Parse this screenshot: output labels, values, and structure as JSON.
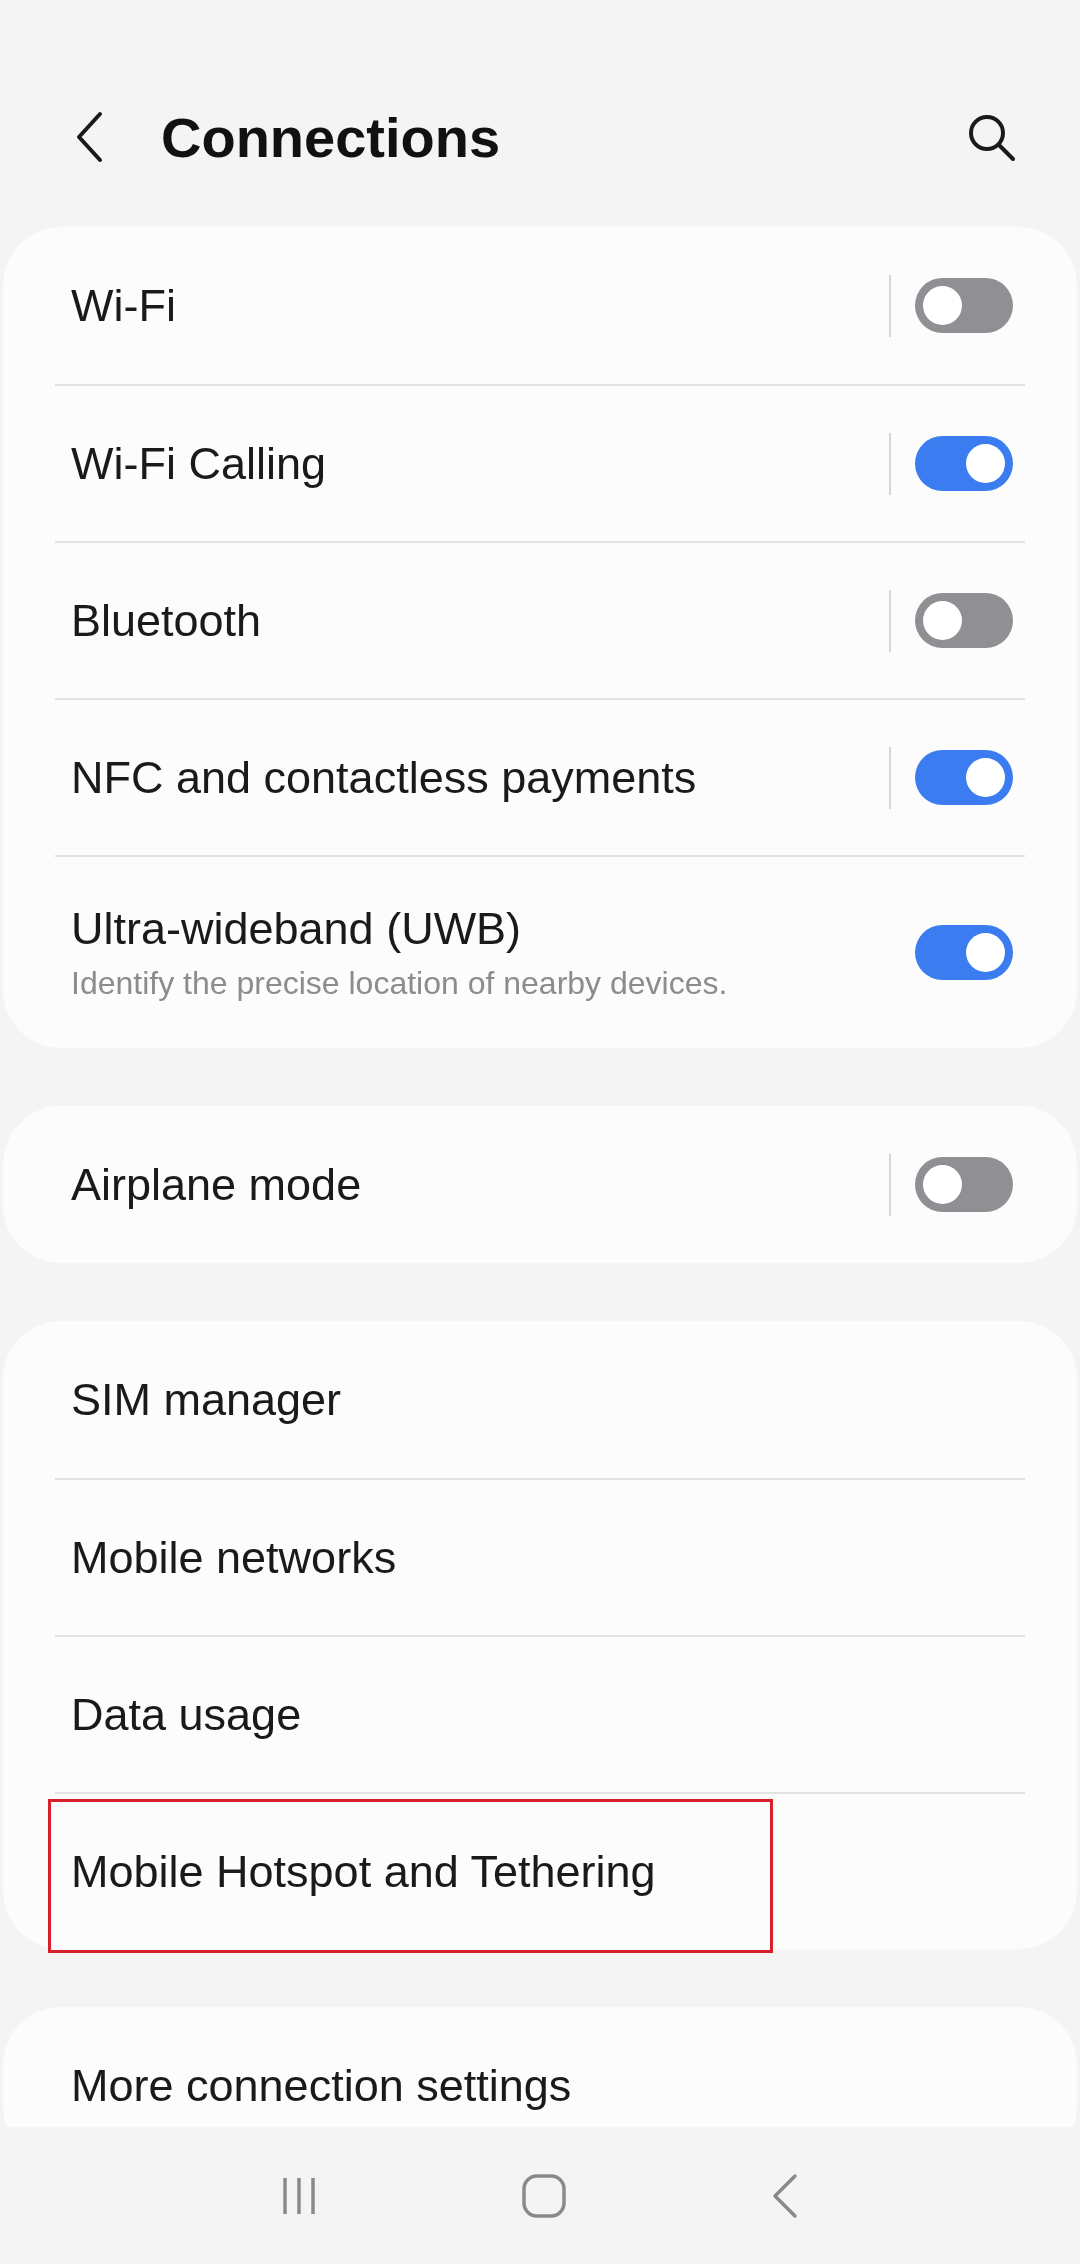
{
  "header": {
    "title": "Connections"
  },
  "groups": [
    {
      "items": [
        {
          "kind": "toggle",
          "label": "Wi-Fi",
          "on": false,
          "split": true,
          "highlighted": false
        },
        {
          "kind": "toggle",
          "label": "Wi-Fi Calling",
          "on": true,
          "split": true,
          "highlighted": false
        },
        {
          "kind": "toggle",
          "label": "Bluetooth",
          "on": false,
          "split": true,
          "highlighted": false
        },
        {
          "kind": "toggle",
          "label": "NFC and contactless payments",
          "on": true,
          "split": true,
          "highlighted": false
        },
        {
          "kind": "toggle",
          "label": "Ultra-wideband (UWB)",
          "subtitle": "Identify the precise location of nearby devices.",
          "on": true,
          "split": false,
          "highlighted": false
        }
      ]
    },
    {
      "items": [
        {
          "kind": "toggle",
          "label": "Airplane mode",
          "on": false,
          "split": true,
          "highlighted": false
        }
      ]
    },
    {
      "items": [
        {
          "kind": "link",
          "label": "SIM manager",
          "highlighted": false
        },
        {
          "kind": "link",
          "label": "Mobile networks",
          "highlighted": false
        },
        {
          "kind": "link",
          "label": "Data usage",
          "highlighted": false
        },
        {
          "kind": "link",
          "label": "Mobile Hotspot and Tethering",
          "highlighted": true
        }
      ]
    },
    {
      "items": [
        {
          "kind": "link",
          "label": "More connection settings",
          "highlighted": false
        }
      ]
    }
  ]
}
